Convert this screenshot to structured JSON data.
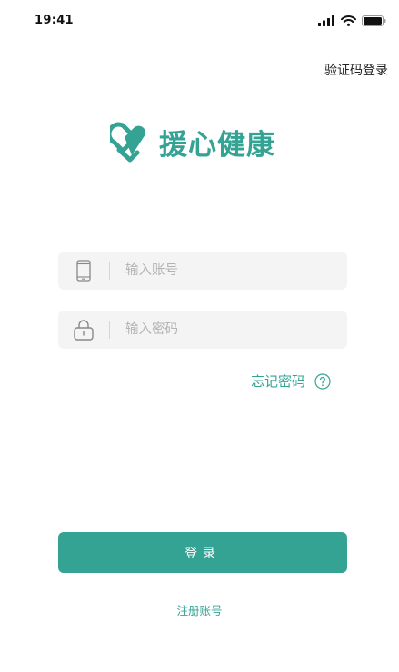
{
  "status_bar": {
    "time": "19:41"
  },
  "header": {
    "alt_login_label": "验证码登录"
  },
  "logo": {
    "text": "援心健康",
    "brand_color": "#35a394"
  },
  "form": {
    "account_placeholder": "输入账号",
    "password_placeholder": "输入密码",
    "forgot_label": "忘记密码",
    "account_icon": "phone-icon",
    "password_icon": "lock-icon",
    "help_icon": "question-circle-icon"
  },
  "actions": {
    "login_label": "登录",
    "register_label": "注册账号"
  }
}
